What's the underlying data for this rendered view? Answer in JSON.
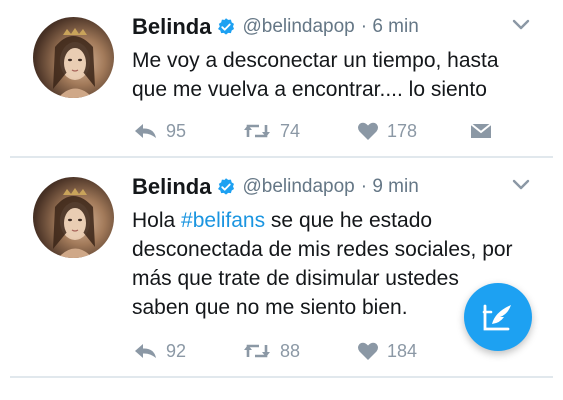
{
  "tweets": [
    {
      "name": "Belinda",
      "handle": "@belindapop",
      "time": "· 6 min",
      "text_lines": [
        "Me voy a desconectar un tiempo, hasta",
        "que me vuelva a encontrar.... lo siento"
      ],
      "replies": "95",
      "retweets": "74",
      "likes": "178",
      "extra_icon": "direct-message-icon"
    },
    {
      "name": "Belinda",
      "handle": "@belindapop",
      "time": "· 9 min",
      "text_prefix": "Hola ",
      "hashtag": "#belifans",
      "text_after_hashtag": " se que he estado",
      "text_lines": [
        "desconectada de mis redes sociales, por",
        "más que trate de disimular ustedes",
        "saben que no me siento bien."
      ],
      "replies": "92",
      "retweets": "88",
      "likes": "184"
    }
  ],
  "compose_button": {
    "icon": "compose-quill-icon"
  },
  "colors": {
    "accent": "#1da1f2",
    "hashtag": "#1b95e0",
    "secondary_text": "#657786",
    "action_gray": "#8b98a5",
    "divider": "#e1e8ed"
  }
}
